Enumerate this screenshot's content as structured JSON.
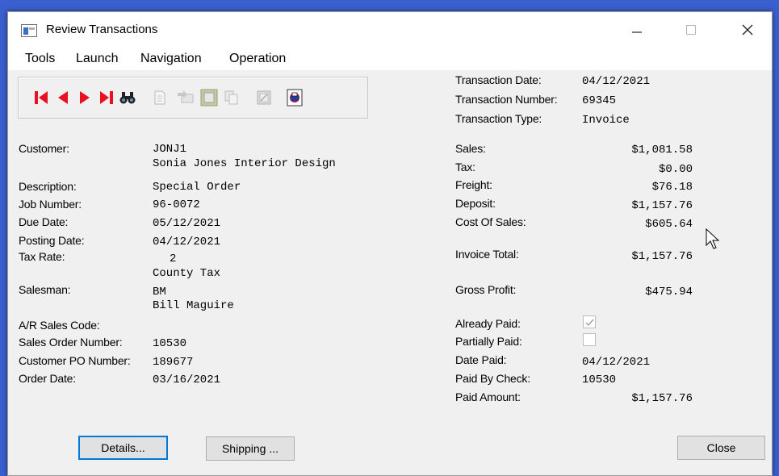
{
  "window": {
    "title": "Review Transactions"
  },
  "menu": [
    "Tools",
    "Launch",
    "Navigation",
    "Operation"
  ],
  "header": {
    "transaction_date_label": "Transaction Date:",
    "transaction_date": "04/12/2021",
    "transaction_number_label": "Transaction Number:",
    "transaction_number": "69345",
    "transaction_type_label": "Transaction Type:",
    "transaction_type": "Invoice"
  },
  "left": {
    "customer_label": "Customer:",
    "customer_code": "JONJ1",
    "customer_name": "Sonia Jones Interior Design",
    "description_label": "Description:",
    "description": "Special Order",
    "job_number_label": "Job Number:",
    "job_number": "96-0072",
    "due_date_label": "Due Date:",
    "due_date": "05/12/2021",
    "posting_date_label": "Posting Date:",
    "posting_date": "04/12/2021",
    "tax_rate_label": "Tax Rate:",
    "tax_rate_code": "2",
    "tax_rate_name": "County Tax",
    "salesman_label": "Salesman:",
    "salesman_code": "BM",
    "salesman_name": "Bill Maguire",
    "ar_sales_code_label": "A/R Sales Code:",
    "sales_order_number_label": "Sales Order Number:",
    "sales_order_number": "10530",
    "customer_po_label": "Customer PO Number:",
    "customer_po": "189677",
    "order_date_label": "Order Date:",
    "order_date": "03/16/2021"
  },
  "right": {
    "sales_label": "Sales:",
    "sales": "$1,081.58",
    "tax_label": "Tax:",
    "tax": "$0.00",
    "freight_label": "Freight:",
    "freight": "$76.18",
    "deposit_label": "Deposit:",
    "deposit": "$1,157.76",
    "cost_of_sales_label": "Cost Of Sales:",
    "cost_of_sales": "$605.64",
    "invoice_total_label": "Invoice Total:",
    "invoice_total": "$1,157.76",
    "gross_profit_label": "Gross Profit:",
    "gross_profit": "$475.94",
    "already_paid_label": "Already Paid:",
    "already_paid_checked": true,
    "partially_paid_label": "Partially Paid:",
    "partially_paid_checked": false,
    "date_paid_label": "Date Paid:",
    "date_paid": "04/12/2021",
    "paid_by_check_label": "Paid By Check:",
    "paid_by_check": "10530",
    "paid_amount_label": "Paid Amount:",
    "paid_amount": "$1,157.76"
  },
  "buttons": {
    "details": "Details...",
    "shipping": "Shipping ...",
    "close": "Close"
  },
  "toolbar_icons": [
    "first-record-icon",
    "previous-record-icon",
    "next-record-icon",
    "last-record-icon",
    "find-binoculars-icon",
    "document-icon",
    "transfer-icon",
    "frame-icon",
    "copy-icon",
    "edit-icon",
    "print-icon"
  ],
  "colors": {
    "nav_red": "#e81123",
    "title_bg": "#ffffff",
    "body_bg": "#f0f0f0",
    "focus_blue": "#0078d7"
  }
}
